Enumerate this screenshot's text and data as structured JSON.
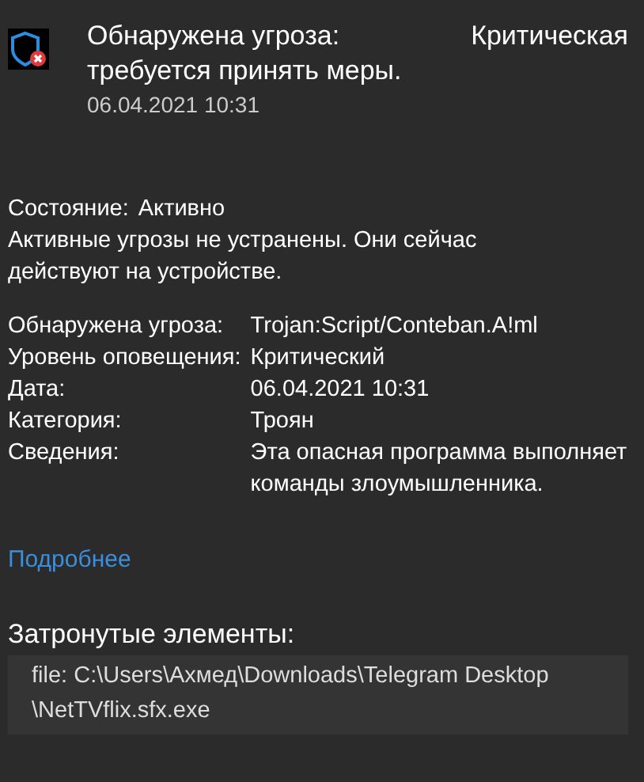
{
  "header": {
    "title": "Обнаружена угроза:",
    "severity": "Критическая",
    "subtitle": "требуется принять меры.",
    "timestamp": "06.04.2021 10:31"
  },
  "status": {
    "label": "Состояние:",
    "value": "Активно",
    "description": "Активные угрозы не устранены. Они сейчас действуют на устройстве."
  },
  "details": [
    {
      "label": "Обнаружена угроза:",
      "value": "Trojan:Script/Conteban.A!ml"
    },
    {
      "label": "Уровень оповещения:",
      "value": "Критический"
    },
    {
      "label": "Дата:",
      "value": "06.04.2021 10:31"
    },
    {
      "label": "Категория:",
      "value": "Троян"
    },
    {
      "label": "Сведения:",
      "value": "Эта опасная программа выполняет команды злоумышленника."
    }
  ],
  "link": "Подробнее",
  "affected": {
    "heading": "Затронутые элементы:",
    "items": [
      "file: C:\\Users\\Ахмед\\Downloads\\Telegram Desktop \\NetTVflix.sfx.exe"
    ]
  }
}
